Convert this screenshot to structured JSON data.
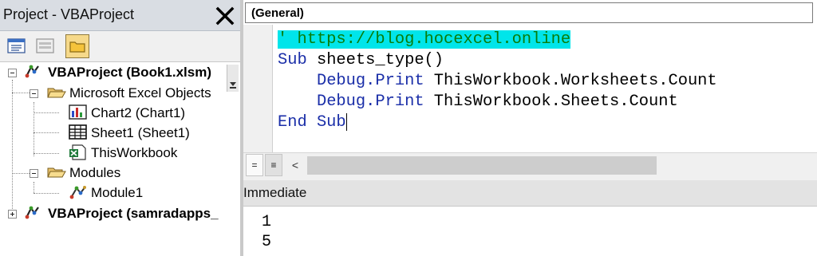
{
  "project_explorer": {
    "title": "Project - VBAProject",
    "toolbar": {
      "view_code_icon": "view-code-icon",
      "view_object_icon": "view-object-icon",
      "toggle_folders_icon": "toggle-folders-icon"
    },
    "tree": {
      "project1": "VBAProject (Book1.xlsm)",
      "excel_objects_folder": "Microsoft Excel Objects",
      "chart2": "Chart2 (Chart1)",
      "sheet1": "Sheet1 (Sheet1)",
      "thisworkbook": "ThisWorkbook",
      "modules_folder": "Modules",
      "module1": "Module1",
      "project2": "VBAProject (samradapps_"
    }
  },
  "code_window": {
    "object_combo": "(General)",
    "lines": {
      "l1": "' https://blog.hocexcel.online",
      "l2_kw": "Sub",
      "l2_rest": " sheets_type()",
      "l3_indent": "    ",
      "l3_kw": "Debug.Print",
      "l3_rest": " ThisWorkbook.Worksheets.Count",
      "l4_indent": "    ",
      "l4_kw": "Debug.Print",
      "l4_rest": " ThisWorkbook.Sheets.Count",
      "l5_kw": "End Sub"
    },
    "statusbar": {
      "procedure_view": "=",
      "module_view": "≡",
      "scroll_left": "<"
    }
  },
  "immediate_window": {
    "title": "Immediate",
    "output": [
      "1",
      "5"
    ]
  },
  "colors": {
    "keyword": "#1a2ea8",
    "comment": "#0a7d0a",
    "highlight": "#00e5ea"
  }
}
